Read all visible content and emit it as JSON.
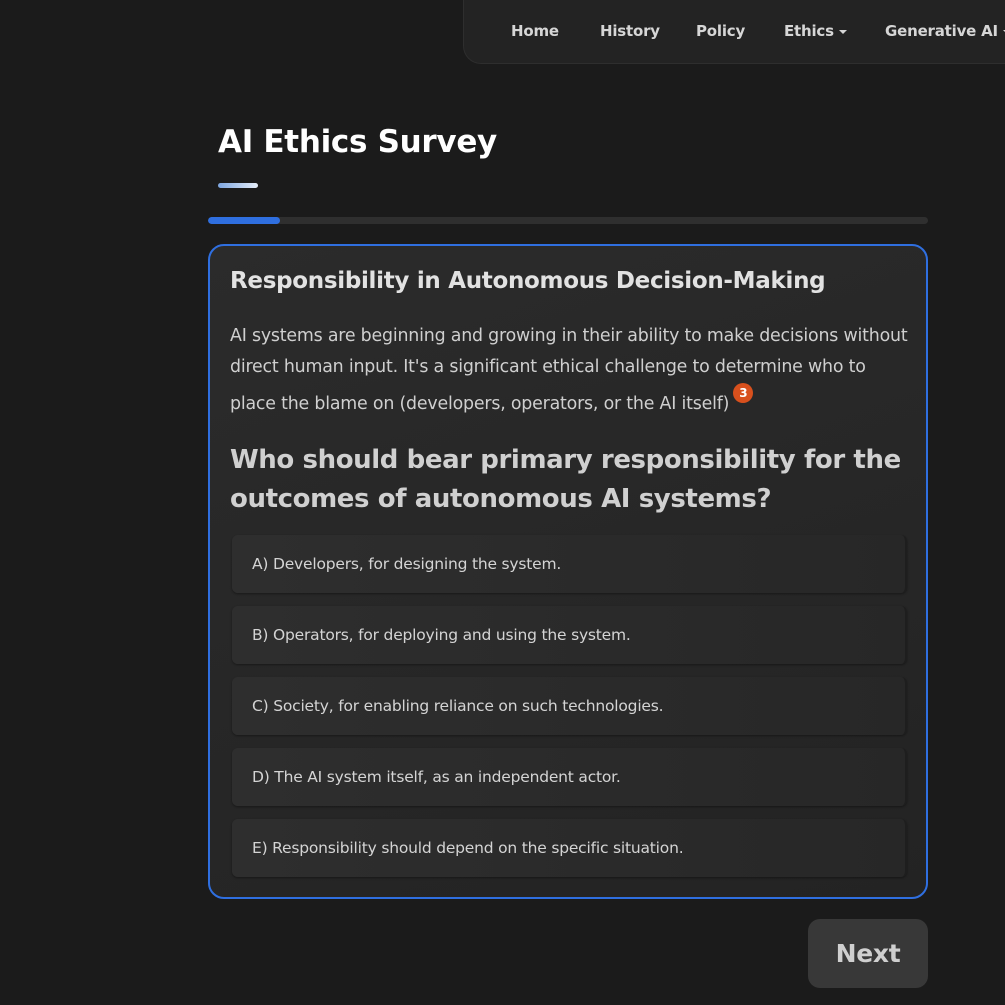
{
  "nav": {
    "items": [
      {
        "label": "Home",
        "dropdown": false
      },
      {
        "label": "History",
        "dropdown": false
      },
      {
        "label": "Policy",
        "dropdown": false
      },
      {
        "label": "Ethics",
        "dropdown": true
      },
      {
        "label": "Generative AI",
        "dropdown": true
      }
    ]
  },
  "page": {
    "title": "AI Ethics Survey"
  },
  "progress": {
    "fraction": 0.1
  },
  "card": {
    "heading": "Responsibility in Autonomous Decision-Making",
    "description": "AI systems are beginning and growing in their ability to make decisions without direct human input. It's a significant ethical challenge to determine who to place the blame on (developers, operators, or the AI itself)",
    "citation": "3",
    "question": "Who should bear primary responsibility for the outcomes of autonomous AI systems?",
    "options": [
      "A) Developers, for designing the system.",
      "B) Operators, for deploying and using the system.",
      "C) Society, for enabling reliance on such technologies.",
      "D) The AI system itself, as an independent actor.",
      "E) Responsibility should depend on the specific situation."
    ]
  },
  "actions": {
    "next_label": "Next"
  },
  "colors": {
    "accent": "#2f6fe0",
    "citation_badge": "#d8501d",
    "background": "#1b1b1b"
  }
}
